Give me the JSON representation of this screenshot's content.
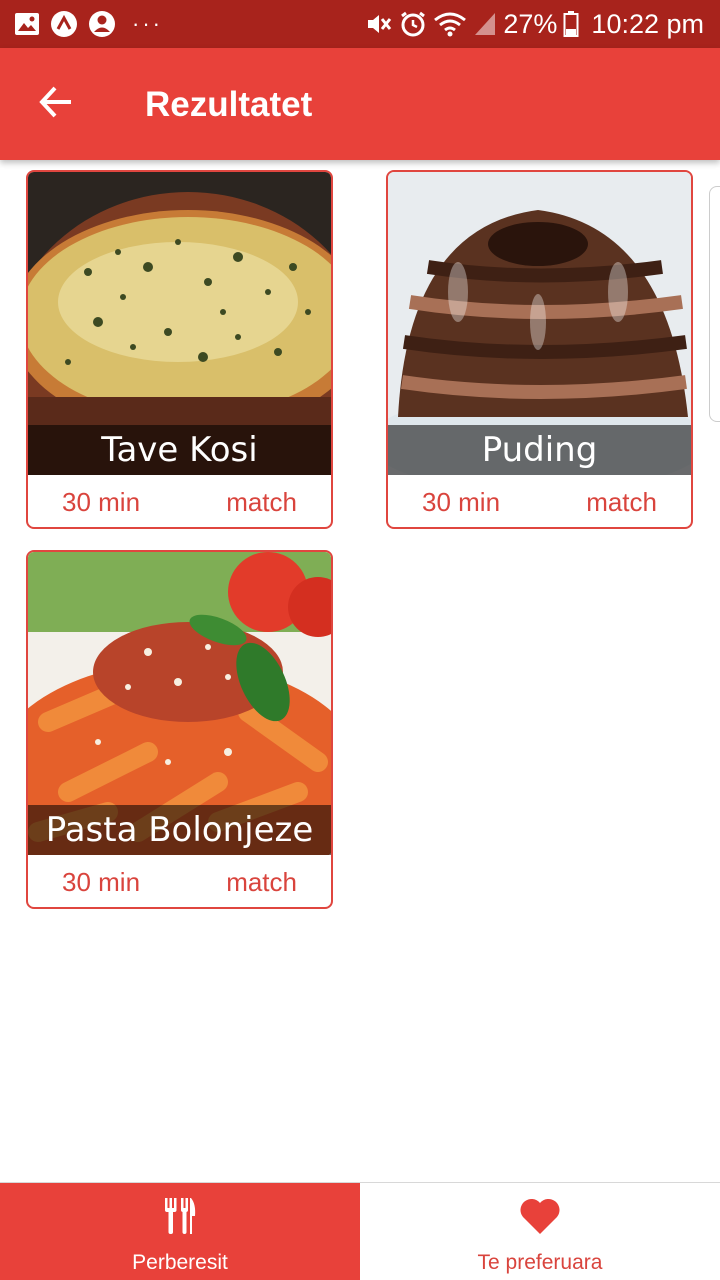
{
  "status_bar": {
    "left_icons": [
      "gallery-icon",
      "app-notification-icon",
      "account-icon",
      "more-dots-icon"
    ],
    "right_icons": [
      "mute-icon",
      "alarm-icon",
      "wifi-icon",
      "signal-icon",
      "battery-icon"
    ],
    "battery_percent": "27%",
    "time": "10:22 pm"
  },
  "app_bar": {
    "title": "Rezultatet",
    "back_icon": "arrow-left-icon",
    "background_color": "#e8413a"
  },
  "results": [
    {
      "title": "Tave Kosi",
      "time": "30 min",
      "match": "match",
      "image": "baked-casserole"
    },
    {
      "title": "Puding",
      "time": "30 min",
      "match": "match",
      "image": "chocolate-pudding"
    },
    {
      "title": "Pasta Bolonjeze",
      "time": "30 min",
      "match": "match",
      "image": "pasta-bolognese"
    }
  ],
  "bottom_nav": {
    "items": [
      {
        "label": "Perberesit",
        "icon": "fork-knife-icon",
        "active": true
      },
      {
        "label": "Te preferuara",
        "icon": "heart-icon",
        "active": false
      }
    ]
  },
  "colors": {
    "accent": "#e8413a",
    "status_bar": "#a8231c",
    "card_text": "#d9443d"
  }
}
